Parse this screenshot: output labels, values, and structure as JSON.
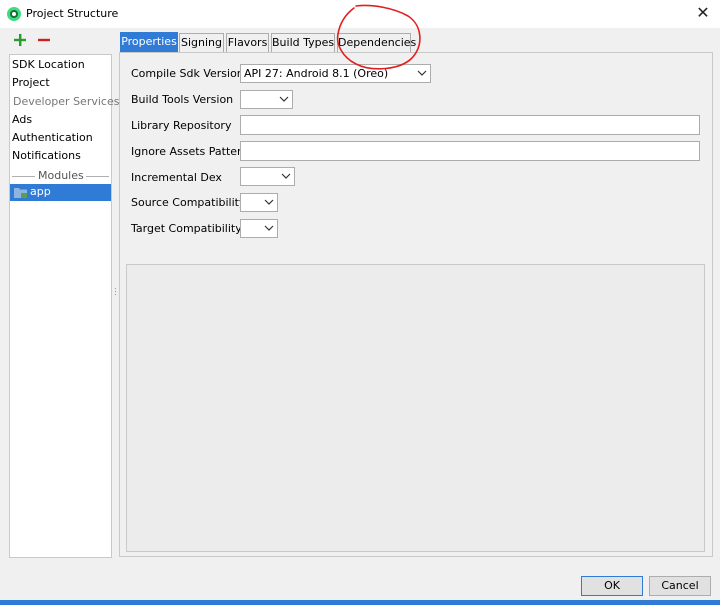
{
  "window": {
    "title": "Project Structure",
    "close_glyph": "✕"
  },
  "toolbar": {
    "add": "add-icon",
    "remove": "remove-icon"
  },
  "sidebar": {
    "items": [
      {
        "label": "SDK Location"
      },
      {
        "label": "Project"
      }
    ],
    "developer_services_header": "Developer Services",
    "service_items": [
      {
        "label": "Ads"
      },
      {
        "label": "Authentication"
      },
      {
        "label": "Notifications"
      }
    ],
    "modules_header": "Modules",
    "modules": [
      {
        "label": "app",
        "selected": true
      }
    ]
  },
  "tabs": [
    {
      "label": "Properties",
      "active": true
    },
    {
      "label": "Signing",
      "active": false
    },
    {
      "label": "Flavors",
      "active": false
    },
    {
      "label": "Build Types",
      "active": false
    },
    {
      "label": "Dependencies",
      "active": false
    }
  ],
  "form": {
    "compile_sdk": {
      "label": "Compile Sdk Version",
      "value": "API 27: Android 8.1 (Oreo)"
    },
    "build_tools": {
      "label": "Build Tools Version",
      "value": ""
    },
    "library_repository": {
      "label": "Library Repository",
      "value": ""
    },
    "ignore_assets": {
      "label": "Ignore Assets Pattern",
      "value": ""
    },
    "incremental_dex": {
      "label": "Incremental Dex",
      "value": ""
    },
    "source_compat": {
      "label": "Source Compatibility",
      "value": ""
    },
    "target_compat": {
      "label": "Target Compatibility",
      "value": ""
    }
  },
  "buttons": {
    "ok": "OK",
    "cancel": "Cancel"
  },
  "colors": {
    "accent": "#2f7bd6",
    "annotation": "#e02020",
    "add": "#2a9a2a",
    "remove": "#cc2222"
  }
}
